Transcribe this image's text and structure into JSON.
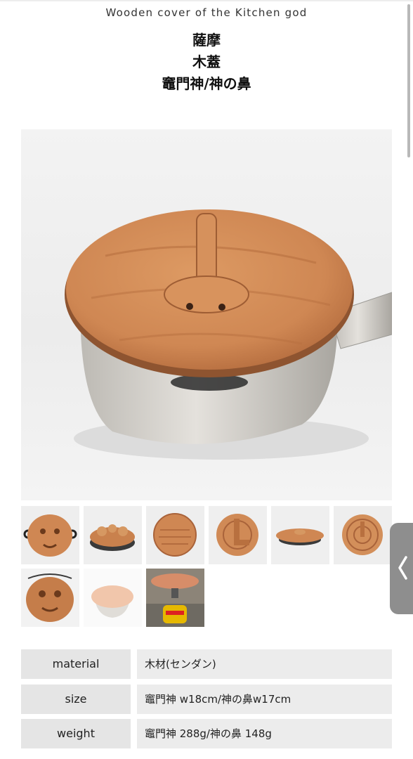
{
  "header": {
    "subtitle": "Wooden cover of the Kitchen god",
    "title_lines": [
      "薩摩",
      "木蓋",
      "竈門神/神の鼻"
    ]
  },
  "gallery": {
    "main_image": "wooden-lid-on-aluminum-pot-photo",
    "thumbnails": [
      "carved-face-lid-thumb",
      "nose-lid-side-thumb",
      "carved-round-lid-thumb",
      "lid-with-handle-thumb",
      "lid-on-pot-side-thumb",
      "round-lid-grain-thumb",
      "carved-face-lid-front-thumb",
      "lid-on-pot-faded-thumb",
      "lid-on-camping-stove-thumb"
    ]
  },
  "specs": [
    {
      "label": "material",
      "value": "木材(センダン)"
    },
    {
      "label": "size",
      "value": "竈門神 w18cm/神の鼻w17cm"
    },
    {
      "label": "weight",
      "value": "竈門神 288g/神の鼻 148g"
    }
  ],
  "side_tab": {
    "icon": "chevron-left-icon"
  },
  "colors": {
    "wood": "#cf8a55",
    "wood_dark": "#a9633a",
    "pot": "#d9d6d0",
    "label_bg": "#e5e5e5",
    "value_bg": "#ececec",
    "side_tab": "#8e8e8e"
  }
}
